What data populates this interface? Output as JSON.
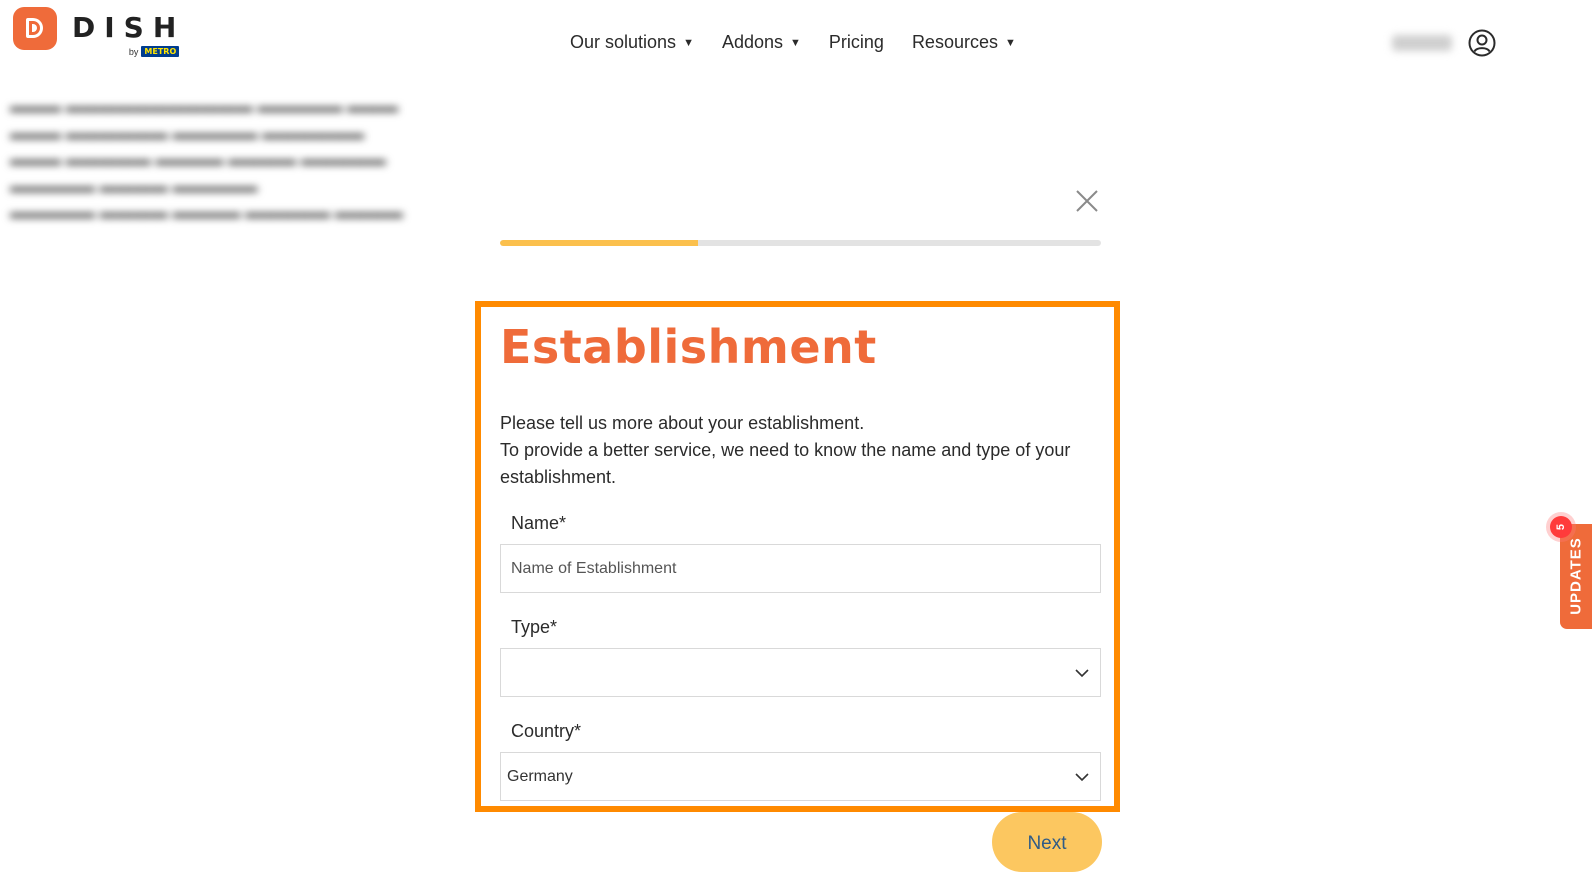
{
  "brand": {
    "name": "DISH",
    "by": "by",
    "partner": "METRO",
    "color": "#ef6b3a"
  },
  "nav": {
    "items": [
      {
        "label": "Our solutions",
        "has_dropdown": true
      },
      {
        "label": "Addons",
        "has_dropdown": true
      },
      {
        "label": "Pricing",
        "has_dropdown": false
      },
      {
        "label": "Resources",
        "has_dropdown": true
      }
    ]
  },
  "user": {
    "icon": "user-circle-icon"
  },
  "progress": {
    "fraction": 0.33,
    "fill_color": "#fbc04d"
  },
  "form": {
    "title": "Establishment",
    "desc_line1": "Please tell us more about your establishment.",
    "desc_line2": "To provide a better service, we need to know the name and type of your establishment.",
    "name_label": "Name*",
    "name_placeholder": "Name of Establishment",
    "name_value": "",
    "type_label": "Type*",
    "type_value": "",
    "country_label": "Country*",
    "country_value": "Germany"
  },
  "next_label": "Next",
  "updates": {
    "label": "UPDATES",
    "badge": "5"
  }
}
